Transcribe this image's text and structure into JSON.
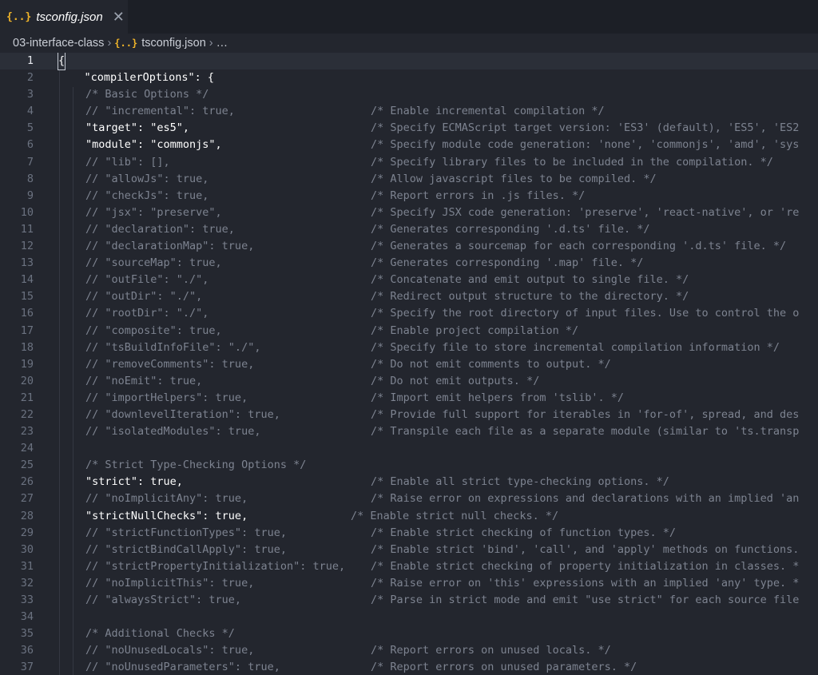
{
  "tab": {
    "icon": "{..}",
    "title": "tsconfig.json",
    "close": "✕"
  },
  "breadcrumb": {
    "folder": "03-interface-class",
    "sep": "›",
    "icon": "{..}",
    "file": "tsconfig.json",
    "more": "…"
  },
  "lines": [
    {
      "n": "1",
      "code": "{",
      "comment": ""
    },
    {
      "n": "2",
      "code": "  \"compilerOptions\": {",
      "comment": ""
    },
    {
      "n": "3",
      "code": "    /* Basic Options */",
      "comment": ""
    },
    {
      "n": "4",
      "code": "    // \"incremental\": true,",
      "comment": "/* Enable incremental compilation */"
    },
    {
      "n": "5",
      "code": "    \"target\": \"es5\",",
      "comment": "/* Specify ECMAScript target version: 'ES3' (default), 'ES5', 'ES2"
    },
    {
      "n": "6",
      "code": "    \"module\": \"commonjs\",",
      "comment": "/* Specify module code generation: 'none', 'commonjs', 'amd', 'sys"
    },
    {
      "n": "7",
      "code": "    // \"lib\": [],",
      "comment": "/* Specify library files to be included in the compilation. */"
    },
    {
      "n": "8",
      "code": "    // \"allowJs\": true,",
      "comment": "/* Allow javascript files to be compiled. */"
    },
    {
      "n": "9",
      "code": "    // \"checkJs\": true,",
      "comment": "/* Report errors in .js files. */"
    },
    {
      "n": "10",
      "code": "    // \"jsx\": \"preserve\",",
      "comment": "/* Specify JSX code generation: 'preserve', 'react-native', or 're"
    },
    {
      "n": "11",
      "code": "    // \"declaration\": true,",
      "comment": "/* Generates corresponding '.d.ts' file. */"
    },
    {
      "n": "12",
      "code": "    // \"declarationMap\": true,",
      "comment": "/* Generates a sourcemap for each corresponding '.d.ts' file. */"
    },
    {
      "n": "13",
      "code": "    // \"sourceMap\": true,",
      "comment": "/* Generates corresponding '.map' file. */"
    },
    {
      "n": "14",
      "code": "    // \"outFile\": \"./\",",
      "comment": "/* Concatenate and emit output to single file. */"
    },
    {
      "n": "15",
      "code": "    // \"outDir\": \"./\",",
      "comment": "/* Redirect output structure to the directory. */"
    },
    {
      "n": "16",
      "code": "    // \"rootDir\": \"./\",",
      "comment": "/* Specify the root directory of input files. Use to control the o"
    },
    {
      "n": "17",
      "code": "    // \"composite\": true,",
      "comment": "/* Enable project compilation */"
    },
    {
      "n": "18",
      "code": "    // \"tsBuildInfoFile\": \"./\",",
      "comment": "/* Specify file to store incremental compilation information */"
    },
    {
      "n": "19",
      "code": "    // \"removeComments\": true,",
      "comment": "/* Do not emit comments to output. */"
    },
    {
      "n": "20",
      "code": "    // \"noEmit\": true,",
      "comment": "/* Do not emit outputs. */"
    },
    {
      "n": "21",
      "code": "    // \"importHelpers\": true,",
      "comment": "/* Import emit helpers from 'tslib'. */"
    },
    {
      "n": "22",
      "code": "    // \"downlevelIteration\": true,",
      "comment": "/* Provide full support for iterables in 'for-of', spread, and des"
    },
    {
      "n": "23",
      "code": "    // \"isolatedModules\": true,",
      "comment": "/* Transpile each file as a separate module (similar to 'ts.transp"
    },
    {
      "n": "24",
      "code": "",
      "comment": ""
    },
    {
      "n": "25",
      "code": "    /* Strict Type-Checking Options */",
      "comment": ""
    },
    {
      "n": "26",
      "code": "    \"strict\": true,",
      "comment": "/* Enable all strict type-checking options. */"
    },
    {
      "n": "27",
      "code": "    // \"noImplicitAny\": true,",
      "comment": "/* Raise error on expressions and declarations with an implied 'an"
    },
    {
      "n": "28",
      "code": "    \"strictNullChecks\": true,",
      "comment": "/* Enable strict null checks. */"
    },
    {
      "n": "29",
      "code": "    // \"strictFunctionTypes\": true,",
      "comment": "/* Enable strict checking of function types. */"
    },
    {
      "n": "30",
      "code": "    // \"strictBindCallApply\": true,",
      "comment": "/* Enable strict 'bind', 'call', and 'apply' methods on functions."
    },
    {
      "n": "31",
      "code": "    // \"strictPropertyInitialization\": true,",
      "comment": "/* Enable strict checking of property initialization in classes. *"
    },
    {
      "n": "32",
      "code": "    // \"noImplicitThis\": true,",
      "comment": "/* Raise error on 'this' expressions with an implied 'any' type. *"
    },
    {
      "n": "33",
      "code": "    // \"alwaysStrict\": true,",
      "comment": "/* Parse in strict mode and emit \"use strict\" for each source file"
    },
    {
      "n": "34",
      "code": "",
      "comment": ""
    },
    {
      "n": "35",
      "code": "    /* Additional Checks */",
      "comment": ""
    },
    {
      "n": "36",
      "code": "    // \"noUnusedLocals\": true,",
      "comment": "/* Report errors on unused locals. */"
    },
    {
      "n": "37",
      "code": "    // \"noUnusedParameters\": true,",
      "comment": "/* Report errors on unused parameters. */"
    }
  ]
}
